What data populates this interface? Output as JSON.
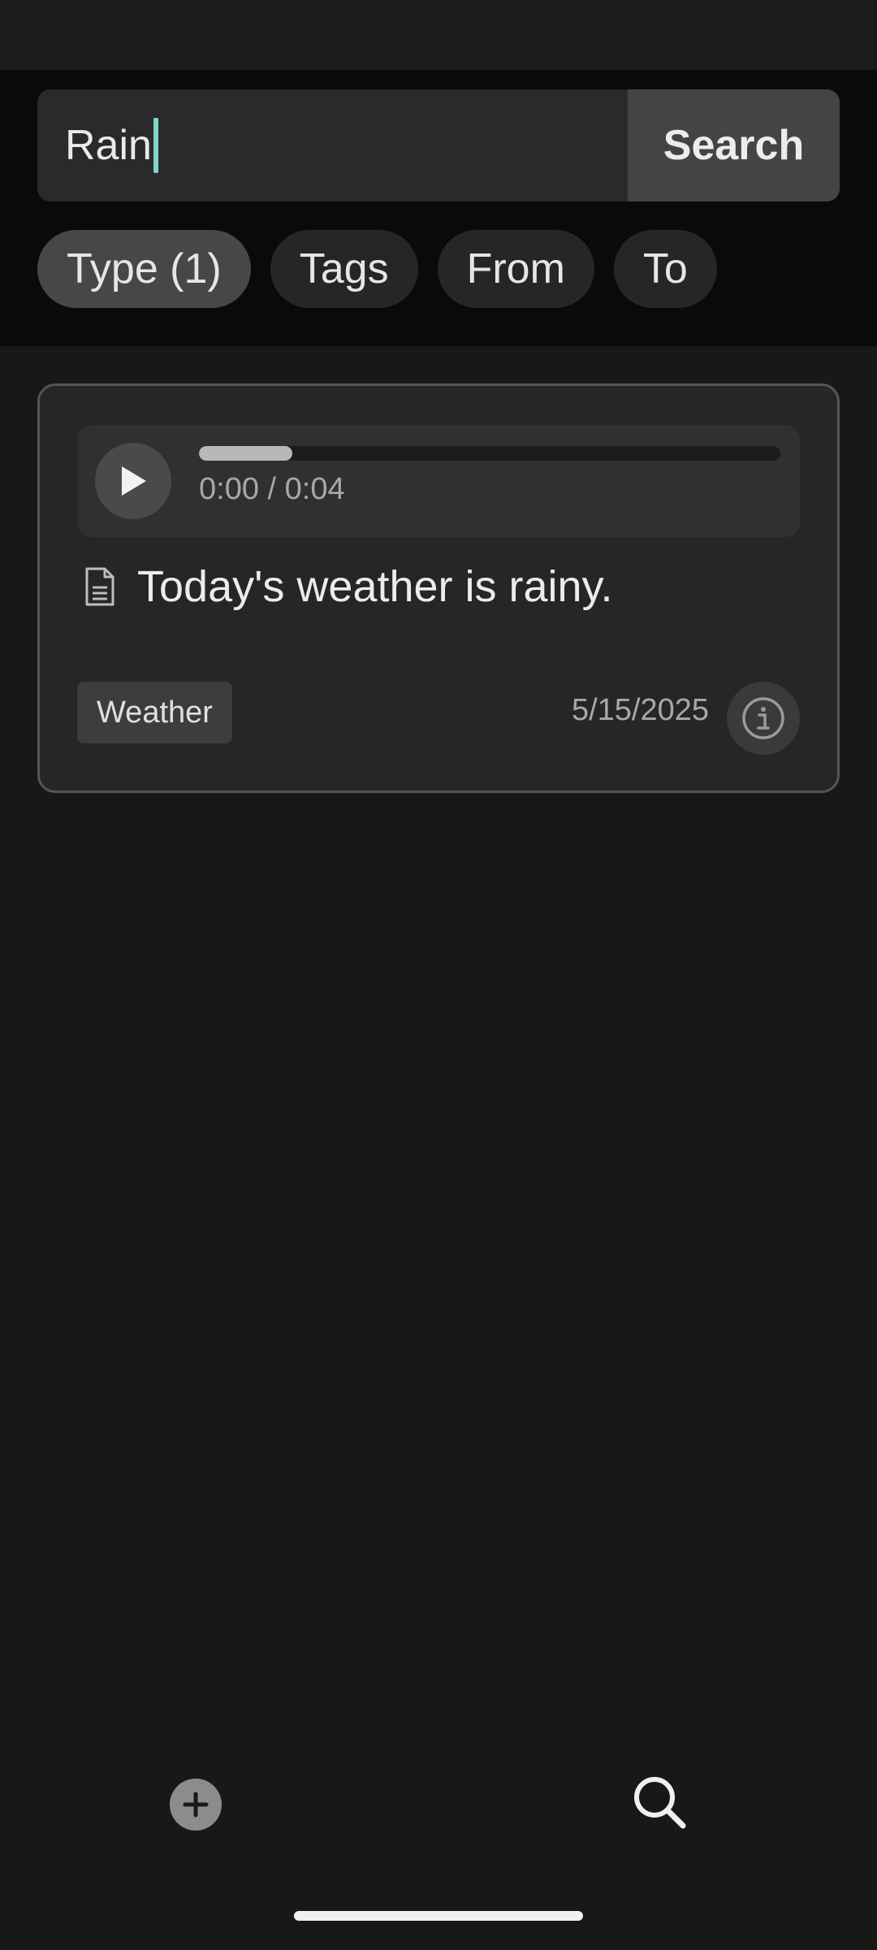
{
  "search": {
    "query": "Rain",
    "button_label": "Search"
  },
  "filters": [
    {
      "label": "Type (1)",
      "active": true
    },
    {
      "label": "Tags",
      "active": false
    },
    {
      "label": "From",
      "active": false
    },
    {
      "label": "To",
      "active": false
    }
  ],
  "results": [
    {
      "player": {
        "time": "0:00 / 0:04",
        "progress": 0.16,
        "play_icon": "play-icon"
      },
      "note_icon": "document-icon",
      "text": "Today's weather is rainy.",
      "tag": "Weather",
      "date": "5/15/2025",
      "info_icon": "info-icon"
    }
  ],
  "bottom_nav": {
    "items": [
      {
        "icon": "add-icon"
      },
      {
        "icon": "search-icon"
      }
    ]
  },
  "colors": {
    "background": "#181818",
    "header": "#0a0a0a",
    "caret": "#7fd6c8",
    "card": "#262626",
    "card_border": "#555555"
  }
}
